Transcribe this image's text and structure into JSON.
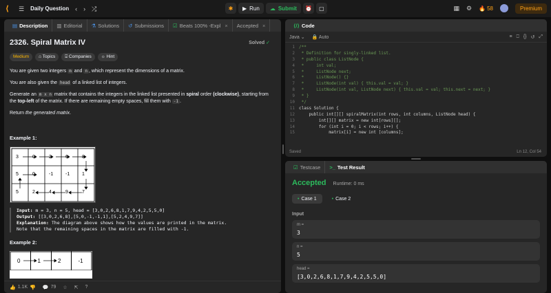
{
  "topbar": {
    "title": "Daily Question",
    "run_label": "Run",
    "submit_label": "Submit",
    "streak_count": "58",
    "premium_label": "Premium"
  },
  "left": {
    "tabs": [
      {
        "label": "Description"
      },
      {
        "label": "Editorial"
      },
      {
        "label": "Solutions"
      },
      {
        "label": "Submissions"
      },
      {
        "label": "Beats 100% -Expl"
      },
      {
        "label": "Accepted"
      }
    ],
    "title": "2326. Spiral Matrix IV",
    "solved_label": "Solved",
    "chips": [
      "Medium",
      "Topics",
      "Companies",
      "Hint"
    ],
    "p1_pre": "You are given two integers ",
    "p1_m": "m",
    "p1_mid": " and ",
    "p1_n": "n",
    "p1_post": ", which represent the dimensions of a matrix.",
    "p2_pre": "You are also given the ",
    "p2_head": "head",
    "p2_post": " of a linked list of integers.",
    "p3_a": "Generate an ",
    "p3_mxn": "m x n",
    "p3_b": " matrix that contains the integers in the linked list presented in ",
    "p3_spiral": "spiral",
    "p3_c": " order ",
    "p3_clock": "(clockwise)",
    "p3_d": ", starting from the ",
    "p3_top": "top-left",
    "p3_e": " of the matrix. If there are remaining empty spaces, fill them with ",
    "p3_neg": "-1",
    "p3_f": ".",
    "p4_a": "Return ",
    "p4_gen": "the generated matrix",
    "p4_b": ".",
    "example1": "Example 1:",
    "example1_input_label": "Input:",
    "example1_input": " m = 3, n = 5, head = [3,0,2,6,8,1,7,9,4,2,5,5,0]",
    "example1_output_label": "Output:",
    "example1_output": " [[3,0,2,6,8],[5,0,-1,-1,1],[5,2,4,9,7]]",
    "example1_expl_label": "Explanation:",
    "example1_expl1": " The diagram above shows how the values are printed in the matrix.",
    "example1_expl2": "Note that the remaining spaces in the matrix are filled with -1.",
    "matrix1": [
      [
        "3",
        "0",
        "2",
        "6",
        "8"
      ],
      [
        "5",
        "0",
        "-1",
        "-1",
        "1"
      ],
      [
        "5",
        "2",
        "4",
        "9",
        "7"
      ]
    ],
    "example2": "Example 2:",
    "matrix2": [
      "0",
      "1",
      "2",
      "-1"
    ],
    "likes": "1.1K",
    "comments": "79"
  },
  "code": {
    "tab_label": "Code",
    "language": "Java",
    "mode": "Auto",
    "lines": [
      {
        "n": "1",
        "t": "/**"
      },
      {
        "n": "2",
        "t": " * Definition for singly-linked list."
      },
      {
        "n": "3",
        "t": " * public class ListNode {"
      },
      {
        "n": "4",
        "t": " *     int val;"
      },
      {
        "n": "5",
        "t": " *     ListNode next;"
      },
      {
        "n": "6",
        "t": " *     ListNode() {}"
      },
      {
        "n": "7",
        "t": " *     ListNode(int val) { this.val = val; }"
      },
      {
        "n": "8",
        "t": " *     ListNode(int val, ListNode next) { this.val = val; this.next = next; }"
      },
      {
        "n": "9",
        "t": " * }"
      },
      {
        "n": "10",
        "t": " */"
      },
      {
        "n": "11",
        "t": "class Solution {"
      },
      {
        "n": "12",
        "t": "    public int[][] spiralMatrix(int rows, int columns, ListNode head) {"
      },
      {
        "n": "13",
        "t": "        int[][] matrix = new int[rows][];"
      },
      {
        "n": "14",
        "t": "        for (int i = 0; i < rows; i++) {"
      },
      {
        "n": "15",
        "t": "            matrix[i] = new int [columns];"
      }
    ],
    "status_left": "Saved",
    "status_right": "Ln 12, Col 54"
  },
  "result": {
    "tabs": [
      "Testcase",
      "Test Result"
    ],
    "status": "Accepted",
    "runtime": "Runtime: 0 ms",
    "cases": [
      "Case 1",
      "Case 2"
    ],
    "input_label": "Input",
    "vars": [
      {
        "name": "m =",
        "value": "3"
      },
      {
        "name": "n =",
        "value": "5"
      },
      {
        "name": "head =",
        "value": "[3,0,2,6,8,1,7,9,4,2,5,5,0]"
      }
    ]
  }
}
